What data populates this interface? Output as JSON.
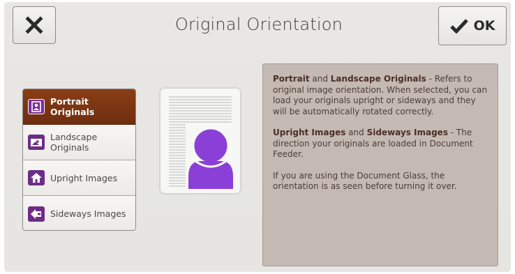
{
  "header": {
    "title": "Original Orientation",
    "ok_label": "OK",
    "close_icon": "close-icon",
    "ok_icon": "checkmark-icon"
  },
  "options": [
    {
      "label": "Portrait Originals",
      "icon": "portrait-icon",
      "selected": true
    },
    {
      "label": "Landscape Originals",
      "icon": "landscape-icon",
      "selected": false
    },
    {
      "label": "Upright Images",
      "icon": "upright-icon",
      "selected": false
    },
    {
      "label": "Sideways Images",
      "icon": "sideways-icon",
      "selected": false
    }
  ],
  "info": {
    "p1_bold1": "Portrait",
    "p1_mid1": " and ",
    "p1_bold2": "Landscape Originals",
    "p1_rest": " - Refers to original image orientation. When selected, you can load your originals upright or sideways and they will be automatically rotated correctly.",
    "p2_bold1": "Upright Images",
    "p2_mid1": " and ",
    "p2_bold2": "Sideways Images",
    "p2_rest": " - The direction your originals are loaded in Document Feeder.",
    "p3": "If you are using the Document Glass, the orientation is as seen before turning it over."
  },
  "colors": {
    "selected_bg": "#7a3413",
    "icon_purple": "#6d2d86",
    "avatar_purple": "#8a3fd6",
    "panel_bg": "#c4b9b3"
  }
}
